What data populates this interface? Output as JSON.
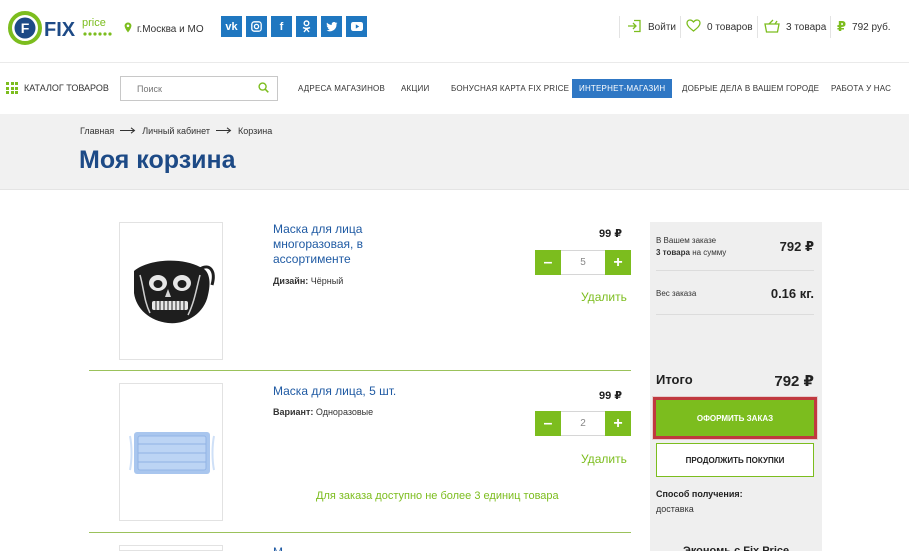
{
  "header": {
    "logo_text": "FIX",
    "logo_sub": "price",
    "city": "г.Москва и МО",
    "social_icons": [
      "vk-icon",
      "instagram-icon",
      "facebook-icon",
      "odnoklassniki-icon",
      "twitter-icon",
      "youtube-icon"
    ],
    "login": "Войти",
    "favorites": "0 товаров",
    "cart": "3 товара",
    "cart_total": "792 руб."
  },
  "nav": {
    "catalog": "КАТАЛОГ ТОВАРОВ",
    "search_placeholder": "Поиск",
    "links": [
      "АДРЕСА МАГАЗИНОВ",
      "АКЦИИ",
      "БОНУСНАЯ КАРТА FIX PRICE",
      "ИНТЕРНЕТ-МАГАЗИН",
      "ДОБРЫЕ ДЕЛА В ВАШЕМ ГОРОДЕ",
      "РАБОТА У НАС"
    ]
  },
  "breadcrumb": {
    "items": [
      "Главная",
      "Личный кабинет",
      "Корзина"
    ]
  },
  "page_title": "Моя корзина",
  "products": [
    {
      "title": "Маска для лица многоразовая, в ассортименте",
      "attr_label": "Дизайн:",
      "attr_value": "Чёрный",
      "price": "99 ₽",
      "qty": "5",
      "remove": "Удалить"
    },
    {
      "title": "Маска для лица, 5 шт.",
      "attr_label": "Вариант:",
      "attr_value": "Одноразовые",
      "price": "99 ₽",
      "qty": "2",
      "remove": "Удалить",
      "notice": "Для заказа доступно не более 3 единиц товара"
    },
    {
      "title": "М"
    }
  ],
  "summary": {
    "in_order_label": "В Вашем заказе",
    "items_count": "3 товара",
    "items_suffix": "на сумму",
    "sum": "792 ₽",
    "weight_label": "Вес заказа",
    "weight": "0.16 кг.",
    "total_label": "Итого",
    "total": "792 ₽",
    "order_button": "ОФОРМИТЬ ЗАКАЗ",
    "continue_button": "ПРОДОЛЖИТЬ ПОКУПКИ",
    "delivery_label": "Способ получения:",
    "delivery_value": "доставка",
    "bottom_cut": "Экономь с Fix Price"
  },
  "colors": {
    "brand_green": "#7cbd1e",
    "brand_blue": "#1d4a86",
    "link_blue": "#1f5aa3",
    "highlight_red": "#c0393f"
  }
}
